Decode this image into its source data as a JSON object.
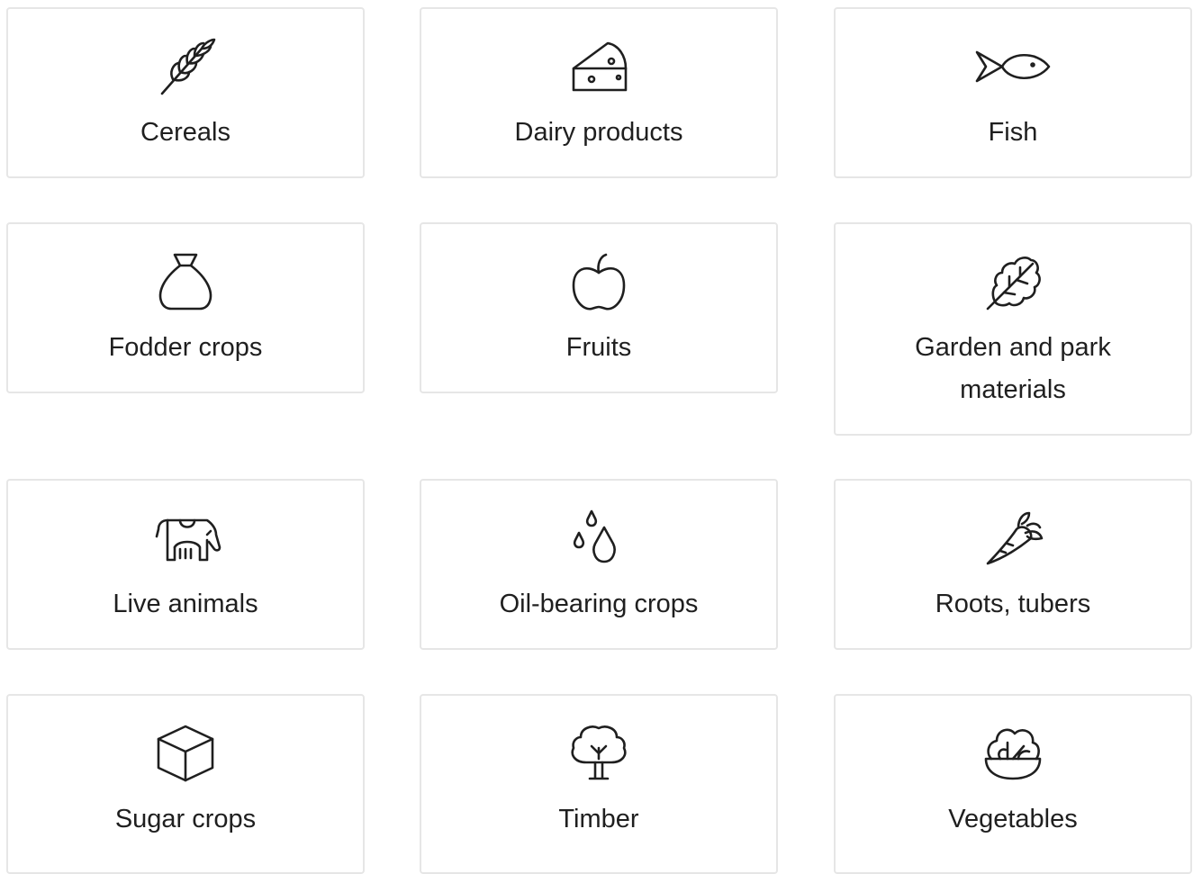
{
  "categories": [
    {
      "label": "Cereals",
      "icon": "wheat-icon"
    },
    {
      "label": "Dairy products",
      "icon": "cheese-icon"
    },
    {
      "label": "Fish",
      "icon": "fish-icon"
    },
    {
      "label": "Fodder crops",
      "icon": "sack-icon"
    },
    {
      "label": "Fruits",
      "icon": "apple-icon"
    },
    {
      "label": "Garden and park materials",
      "icon": "leaf-icon"
    },
    {
      "label": "Live animals",
      "icon": "cow-icon"
    },
    {
      "label": "Oil-bearing crops",
      "icon": "oil-drops-icon"
    },
    {
      "label": "Roots, tubers",
      "icon": "carrot-icon"
    },
    {
      "label": "Sugar crops",
      "icon": "sugar-cube-icon"
    },
    {
      "label": "Timber",
      "icon": "tree-icon"
    },
    {
      "label": "Vegetables",
      "icon": "salad-bowl-icon"
    }
  ]
}
